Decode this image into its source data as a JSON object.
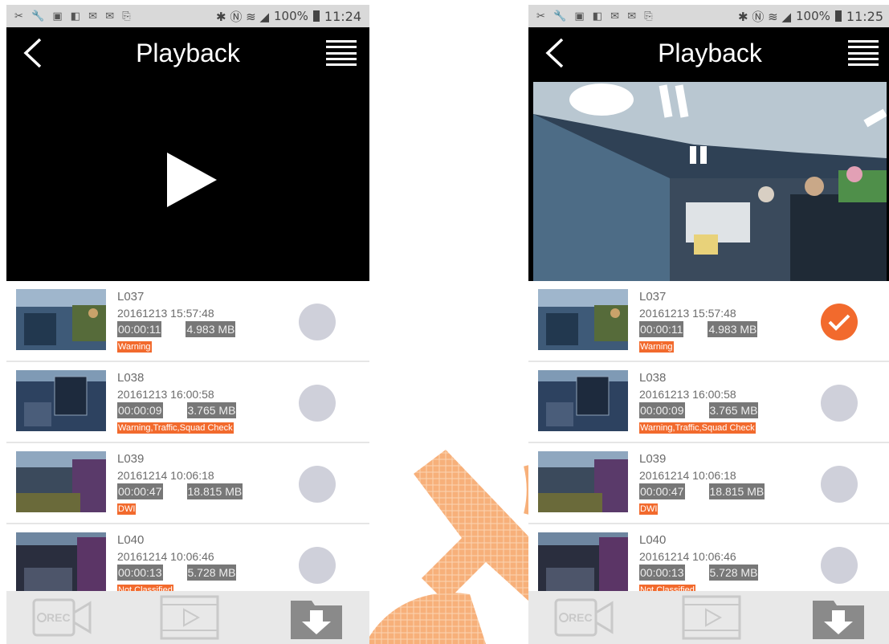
{
  "screens": [
    {
      "status": {
        "icons": "✂ 🔧 ▣ ◧ ✉ ✉ ⎘",
        "right_icons": "✱ Ⓝ ≋ ◢",
        "battery": "100%",
        "time": "11:24"
      },
      "header": {
        "title": "Playback"
      },
      "player": {
        "state": "stopped"
      },
      "clips": [
        {
          "name": "L037",
          "datetime": "20161213 15:57:48",
          "duration": "00:00:11",
          "size": "4.983 MB",
          "tag": "Warning",
          "selected": false
        },
        {
          "name": "L038",
          "datetime": "20161213 16:00:58",
          "duration": "00:00:09",
          "size": "3.765 MB",
          "tag": "Warning,Traffic,Squad Check",
          "selected": false
        },
        {
          "name": "L039",
          "datetime": "20161214 10:06:18",
          "duration": "00:00:47",
          "size": "18.815 MB",
          "tag": "DWI",
          "selected": false
        },
        {
          "name": "L040",
          "datetime": "20161214 10:06:46",
          "duration": "00:00:13",
          "size": "5.728 MB",
          "tag": "Not Classified",
          "selected": false
        }
      ]
    },
    {
      "status": {
        "icons": "✂ 🔧 ▣ ◧ ✉ ✉ ⎘",
        "right_icons": "✱ Ⓝ ≋ ◢",
        "battery": "100%",
        "time": "11:25"
      },
      "header": {
        "title": "Playback"
      },
      "player": {
        "state": "playing"
      },
      "clips": [
        {
          "name": "L037",
          "datetime": "20161213 15:57:48",
          "duration": "00:00:11",
          "size": "4.983 MB",
          "tag": "Warning",
          "selected": true
        },
        {
          "name": "L038",
          "datetime": "20161213 16:00:58",
          "duration": "00:00:09",
          "size": "3.765 MB",
          "tag": "Warning,Traffic,Squad Check",
          "selected": false
        },
        {
          "name": "L039",
          "datetime": "20161214 10:06:18",
          "duration": "00:00:47",
          "size": "18.815 MB",
          "tag": "DWI",
          "selected": false
        },
        {
          "name": "L040",
          "datetime": "20161214 10:06:46",
          "duration": "00:00:13",
          "size": "5.728 MB",
          "tag": "Not Classified",
          "selected": false
        }
      ]
    }
  ],
  "bottom_bar": {
    "record_label": "REC",
    "icons": [
      "record-camera-icon",
      "video-playback-icon",
      "download-icon"
    ]
  },
  "colors": {
    "accent": "#f26a2d",
    "header": "#000000",
    "status_bar": "#d9d9d9",
    "unselected": "#cfd0da"
  }
}
